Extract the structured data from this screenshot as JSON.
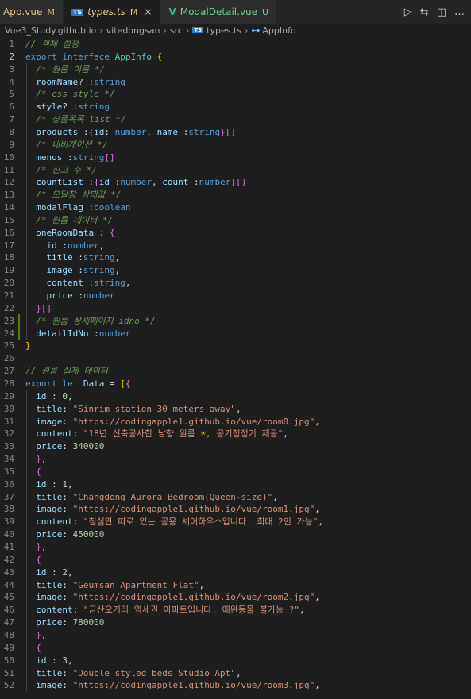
{
  "tabs": [
    {
      "icon": "vue-icon",
      "label": "App.vue",
      "status": "M",
      "active": false
    },
    {
      "icon": "ts-icon",
      "label": "types.ts",
      "status": "M",
      "active": true
    },
    {
      "icon": "vue-icon",
      "label": "ModalDetail.vue",
      "status": "U",
      "active": false
    }
  ],
  "breadcrumb": [
    "Vue3_Study.github.io",
    "vitedongsan",
    "src",
    "types.ts",
    "AppInfo"
  ],
  "colors": {
    "background": "#1e1e1e",
    "keyword": "#569cd6",
    "type": "#4ec9b0",
    "variable": "#9cdcfe",
    "comment": "#6a9955",
    "string": "#ce9178",
    "number": "#b5cea8",
    "git_added": "#587c0c"
  },
  "editor": {
    "current_line": 2,
    "lines": [
      {
        "n": 1,
        "tokens": [
          [
            "cm",
            "// 객체 설정"
          ]
        ]
      },
      {
        "n": 2,
        "tokens": [
          [
            "kw",
            "export"
          ],
          [
            "pn",
            " "
          ],
          [
            "kw",
            "interface"
          ],
          [
            "pn",
            " "
          ],
          [
            "ty",
            "AppInfo"
          ],
          [
            "pn",
            " "
          ],
          [
            "br",
            "{"
          ]
        ]
      },
      {
        "n": 3,
        "tokens": [
          [
            "pn",
            "  "
          ],
          [
            "cm",
            "/* 원룸 이름 */"
          ]
        ]
      },
      {
        "n": 4,
        "tokens": [
          [
            "pn",
            "  "
          ],
          [
            "var",
            "roomName"
          ],
          [
            "pn",
            "? :"
          ],
          [
            "kw",
            "string"
          ]
        ]
      },
      {
        "n": 5,
        "tokens": [
          [
            "pn",
            "  "
          ],
          [
            "cm",
            "/* css style */"
          ]
        ]
      },
      {
        "n": 6,
        "tokens": [
          [
            "pn",
            "  "
          ],
          [
            "var",
            "style"
          ],
          [
            "pn",
            "? :"
          ],
          [
            "kw",
            "string"
          ]
        ]
      },
      {
        "n": 7,
        "tokens": [
          [
            "pn",
            "  "
          ],
          [
            "cm",
            "/* 상품목록 list */"
          ]
        ]
      },
      {
        "n": 8,
        "tokens": [
          [
            "pn",
            "  "
          ],
          [
            "var",
            "products"
          ],
          [
            "pn",
            " :"
          ],
          [
            "br2",
            "{"
          ],
          [
            "var",
            "id"
          ],
          [
            "pn",
            ": "
          ],
          [
            "kw",
            "number"
          ],
          [
            "pn",
            ", "
          ],
          [
            "var",
            "name"
          ],
          [
            "pn",
            " :"
          ],
          [
            "kw",
            "string"
          ],
          [
            "br2",
            "}[]"
          ]
        ]
      },
      {
        "n": 9,
        "tokens": [
          [
            "pn",
            "  "
          ],
          [
            "cm",
            "/* 내비게이션 */"
          ]
        ]
      },
      {
        "n": 10,
        "tokens": [
          [
            "pn",
            "  "
          ],
          [
            "var",
            "menus"
          ],
          [
            "pn",
            " :"
          ],
          [
            "kw",
            "string"
          ],
          [
            "br2",
            "[]"
          ]
        ]
      },
      {
        "n": 11,
        "tokens": [
          [
            "pn",
            "  "
          ],
          [
            "cm",
            "/* 신고 수 */"
          ]
        ]
      },
      {
        "n": 12,
        "tokens": [
          [
            "pn",
            "  "
          ],
          [
            "var",
            "countList"
          ],
          [
            "pn",
            " :"
          ],
          [
            "br2",
            "{"
          ],
          [
            "var",
            "id"
          ],
          [
            "pn",
            " :"
          ],
          [
            "kw",
            "number"
          ],
          [
            "pn",
            ", "
          ],
          [
            "var",
            "count"
          ],
          [
            "pn",
            " :"
          ],
          [
            "kw",
            "number"
          ],
          [
            "br2",
            "}[]"
          ]
        ]
      },
      {
        "n": 13,
        "tokens": [
          [
            "pn",
            "  "
          ],
          [
            "cm",
            "/* 모달창 상태값 */"
          ]
        ]
      },
      {
        "n": 14,
        "tokens": [
          [
            "pn",
            "  "
          ],
          [
            "var",
            "modalFlag"
          ],
          [
            "pn",
            " :"
          ],
          [
            "kw",
            "boolean"
          ]
        ]
      },
      {
        "n": 15,
        "tokens": [
          [
            "pn",
            "  "
          ],
          [
            "cm",
            "/* 원룸 데이터 */"
          ]
        ]
      },
      {
        "n": 16,
        "tokens": [
          [
            "pn",
            "  "
          ],
          [
            "var",
            "oneRoomData"
          ],
          [
            "pn",
            " : "
          ],
          [
            "br2",
            "{"
          ]
        ]
      },
      {
        "n": 17,
        "tokens": [
          [
            "pn",
            "    "
          ],
          [
            "var",
            "id"
          ],
          [
            "pn",
            " :"
          ],
          [
            "kw",
            "number"
          ],
          [
            "pn",
            ","
          ]
        ]
      },
      {
        "n": 18,
        "tokens": [
          [
            "pn",
            "    "
          ],
          [
            "var",
            "title"
          ],
          [
            "pn",
            " :"
          ],
          [
            "kw",
            "string"
          ],
          [
            "pn",
            ","
          ]
        ]
      },
      {
        "n": 19,
        "tokens": [
          [
            "pn",
            "    "
          ],
          [
            "var",
            "image"
          ],
          [
            "pn",
            " :"
          ],
          [
            "kw",
            "string"
          ],
          [
            "pn",
            ","
          ]
        ]
      },
      {
        "n": 20,
        "tokens": [
          [
            "pn",
            "    "
          ],
          [
            "var",
            "content"
          ],
          [
            "pn",
            " :"
          ],
          [
            "kw",
            "string"
          ],
          [
            "pn",
            ","
          ]
        ]
      },
      {
        "n": 21,
        "tokens": [
          [
            "pn",
            "    "
          ],
          [
            "var",
            "price"
          ],
          [
            "pn",
            " :"
          ],
          [
            "kw",
            "number"
          ]
        ]
      },
      {
        "n": 22,
        "tokens": [
          [
            "pn",
            "  "
          ],
          [
            "br2",
            "}[]"
          ]
        ]
      },
      {
        "n": 23,
        "tokens": [
          [
            "pn",
            "  "
          ],
          [
            "cm",
            "/* 원룸 상세페이지 idno */"
          ]
        ]
      },
      {
        "n": 24,
        "tokens": [
          [
            "pn",
            "  "
          ],
          [
            "var",
            "detailIdNo"
          ],
          [
            "pn",
            " :"
          ],
          [
            "kw",
            "number"
          ]
        ]
      },
      {
        "n": 25,
        "tokens": [
          [
            "br",
            "}"
          ]
        ]
      },
      {
        "n": 26,
        "tokens": []
      },
      {
        "n": 27,
        "tokens": [
          [
            "cm",
            "// 원룸 실제 데이터"
          ]
        ]
      },
      {
        "n": 28,
        "tokens": [
          [
            "kw",
            "export"
          ],
          [
            "pn",
            " "
          ],
          [
            "kw",
            "let"
          ],
          [
            "pn",
            " "
          ],
          [
            "var",
            "Data"
          ],
          [
            "pn",
            " = "
          ],
          [
            "br",
            "["
          ],
          [
            "br2",
            "{"
          ]
        ]
      },
      {
        "n": 29,
        "tokens": [
          [
            "pn",
            "  "
          ],
          [
            "var",
            "id"
          ],
          [
            "pn",
            " : "
          ],
          [
            "num",
            "0"
          ],
          [
            "pn",
            ","
          ]
        ]
      },
      {
        "n": 30,
        "tokens": [
          [
            "pn",
            "  "
          ],
          [
            "var",
            "title"
          ],
          [
            "pn",
            ": "
          ],
          [
            "str",
            "\"Sinrim station 30 meters away\""
          ],
          [
            "pn",
            ","
          ]
        ]
      },
      {
        "n": 31,
        "tokens": [
          [
            "pn",
            "  "
          ],
          [
            "var",
            "image"
          ],
          [
            "pn",
            ": "
          ],
          [
            "str",
            "\"https://codingapple1.github.io/vue/room0.jpg\""
          ],
          [
            "pn",
            ","
          ]
        ]
      },
      {
        "n": 32,
        "tokens": [
          [
            "pn",
            "  "
          ],
          [
            "var",
            "content"
          ],
          [
            "pn",
            ": "
          ],
          [
            "str",
            "\"18년 신축공사한 남향 원룸 "
          ],
          [
            "br",
            "☀"
          ],
          [
            "str",
            ", 공기청정기 제공\""
          ],
          [
            "pn",
            ","
          ]
        ]
      },
      {
        "n": 33,
        "tokens": [
          [
            "pn",
            "  "
          ],
          [
            "var",
            "price"
          ],
          [
            "pn",
            ": "
          ],
          [
            "num",
            "340000"
          ]
        ]
      },
      {
        "n": 34,
        "tokens": [
          [
            "pn",
            "  "
          ],
          [
            "br2",
            "}"
          ],
          [
            "pn",
            ","
          ]
        ]
      },
      {
        "n": 35,
        "tokens": [
          [
            "pn",
            "  "
          ],
          [
            "br2",
            "{"
          ]
        ]
      },
      {
        "n": 36,
        "tokens": [
          [
            "pn",
            "  "
          ],
          [
            "var",
            "id"
          ],
          [
            "pn",
            " : "
          ],
          [
            "num",
            "1"
          ],
          [
            "pn",
            ","
          ]
        ]
      },
      {
        "n": 37,
        "tokens": [
          [
            "pn",
            "  "
          ],
          [
            "var",
            "title"
          ],
          [
            "pn",
            ": "
          ],
          [
            "str",
            "\"Changdong Aurora Bedroom(Queen-size)\""
          ],
          [
            "pn",
            ","
          ]
        ]
      },
      {
        "n": 38,
        "tokens": [
          [
            "pn",
            "  "
          ],
          [
            "var",
            "image"
          ],
          [
            "pn",
            ": "
          ],
          [
            "str",
            "\"https://codingapple1.github.io/vue/room1.jpg\""
          ],
          [
            "pn",
            ","
          ]
        ]
      },
      {
        "n": 39,
        "tokens": [
          [
            "pn",
            "  "
          ],
          [
            "var",
            "content"
          ],
          [
            "pn",
            ": "
          ],
          [
            "str",
            "\"침실만 따로 있는 공용 셰어하우스입니다. 최대 2인 가능\""
          ],
          [
            "pn",
            ","
          ]
        ]
      },
      {
        "n": 40,
        "tokens": [
          [
            "pn",
            "  "
          ],
          [
            "var",
            "price"
          ],
          [
            "pn",
            ": "
          ],
          [
            "num",
            "450000"
          ]
        ]
      },
      {
        "n": 41,
        "tokens": [
          [
            "pn",
            "  "
          ],
          [
            "br2",
            "}"
          ],
          [
            "pn",
            ","
          ]
        ]
      },
      {
        "n": 42,
        "tokens": [
          [
            "pn",
            "  "
          ],
          [
            "br2",
            "{"
          ]
        ]
      },
      {
        "n": 43,
        "tokens": [
          [
            "pn",
            "  "
          ],
          [
            "var",
            "id"
          ],
          [
            "pn",
            " : "
          ],
          [
            "num",
            "2"
          ],
          [
            "pn",
            ","
          ]
        ]
      },
      {
        "n": 44,
        "tokens": [
          [
            "pn",
            "  "
          ],
          [
            "var",
            "title"
          ],
          [
            "pn",
            ": "
          ],
          [
            "str",
            "\"Geumsan Apartment Flat\""
          ],
          [
            "pn",
            ","
          ]
        ]
      },
      {
        "n": 45,
        "tokens": [
          [
            "pn",
            "  "
          ],
          [
            "var",
            "image"
          ],
          [
            "pn",
            ": "
          ],
          [
            "str",
            "\"https://codingapple1.github.io/vue/room2.jpg\""
          ],
          [
            "pn",
            ","
          ]
        ]
      },
      {
        "n": 46,
        "tokens": [
          [
            "pn",
            "  "
          ],
          [
            "var",
            "content"
          ],
          [
            "pn",
            ": "
          ],
          [
            "str",
            "\"금산오거리 역세권 아파트입니다. 애완동물 불가능 ?\""
          ],
          [
            "pn",
            ","
          ]
        ]
      },
      {
        "n": 47,
        "tokens": [
          [
            "pn",
            "  "
          ],
          [
            "var",
            "price"
          ],
          [
            "pn",
            ": "
          ],
          [
            "num",
            "780000"
          ]
        ]
      },
      {
        "n": 48,
        "tokens": [
          [
            "pn",
            "  "
          ],
          [
            "br2",
            "}"
          ],
          [
            "pn",
            ","
          ]
        ]
      },
      {
        "n": 49,
        "tokens": [
          [
            "pn",
            "  "
          ],
          [
            "br2",
            "{"
          ]
        ]
      },
      {
        "n": 50,
        "tokens": [
          [
            "pn",
            "  "
          ],
          [
            "var",
            "id"
          ],
          [
            "pn",
            " : "
          ],
          [
            "num",
            "3"
          ],
          [
            "pn",
            ","
          ]
        ]
      },
      {
        "n": 51,
        "tokens": [
          [
            "pn",
            "  "
          ],
          [
            "var",
            "title"
          ],
          [
            "pn",
            ": "
          ],
          [
            "str",
            "\"Double styled beds Studio Apt\""
          ],
          [
            "pn",
            ","
          ]
        ]
      },
      {
        "n": 52,
        "tokens": [
          [
            "pn",
            "  "
          ],
          [
            "var",
            "image"
          ],
          [
            "pn",
            ": "
          ],
          [
            "str",
            "\"https://codingapple1.github.io/vue/room3.jpg\""
          ],
          [
            "pn",
            ","
          ]
        ]
      }
    ]
  }
}
